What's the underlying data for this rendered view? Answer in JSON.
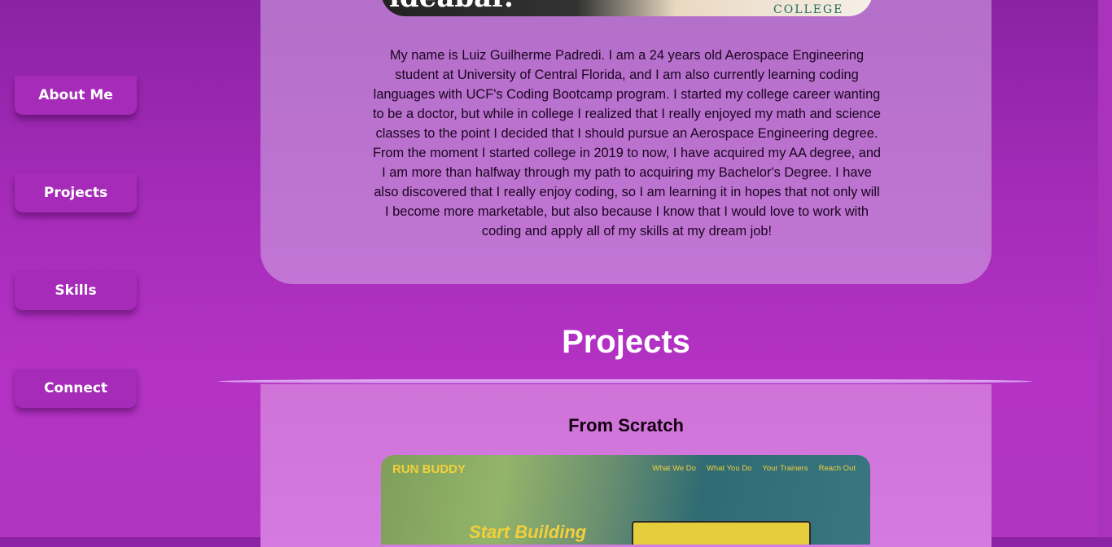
{
  "nav": {
    "items": [
      {
        "label": "About Me"
      },
      {
        "label": "Projects"
      },
      {
        "label": "Skills"
      },
      {
        "label": "Connect"
      }
    ]
  },
  "about": {
    "image": {
      "left_text": "ideabar.",
      "right_text": "COLLEGE"
    },
    "bio": "My name is Luiz Guilherme Padredi. I am a 24 years old Aerospace Engineering student at University of Central Florida, and I am also currently learning coding languages with UCF's Coding Bootcamp program. I started my college career wanting to be a doctor, but while in college I realized that I really enjoyed my math and science classes to the point I decided that I should pursue an Aerospace Engineering degree. From the moment I started college in 2019 to now, I have acquired my AA degree, and I am more than halfway through my path to acquiring my Bachelor's Degree. I have also discovered that I really enjoy coding, so I am learning it in hopes that not only will I become more marketable, but also because I know that I would love to work with coding and apply all of my skills at my dream job!"
  },
  "projects": {
    "title": "Projects",
    "items": [
      {
        "title": "From Scratch",
        "screenshot": {
          "brand": "RUN BUDDY",
          "nav": [
            "What We Do",
            "What You Do",
            "Your Trainers",
            "Reach Out"
          ],
          "hero": "Start Building"
        }
      }
    ]
  },
  "colors": {
    "background": "#a62cba",
    "nav_button": "#a52bb8",
    "card": "#c275d4",
    "accent_yellow": "#f2cf3b"
  }
}
